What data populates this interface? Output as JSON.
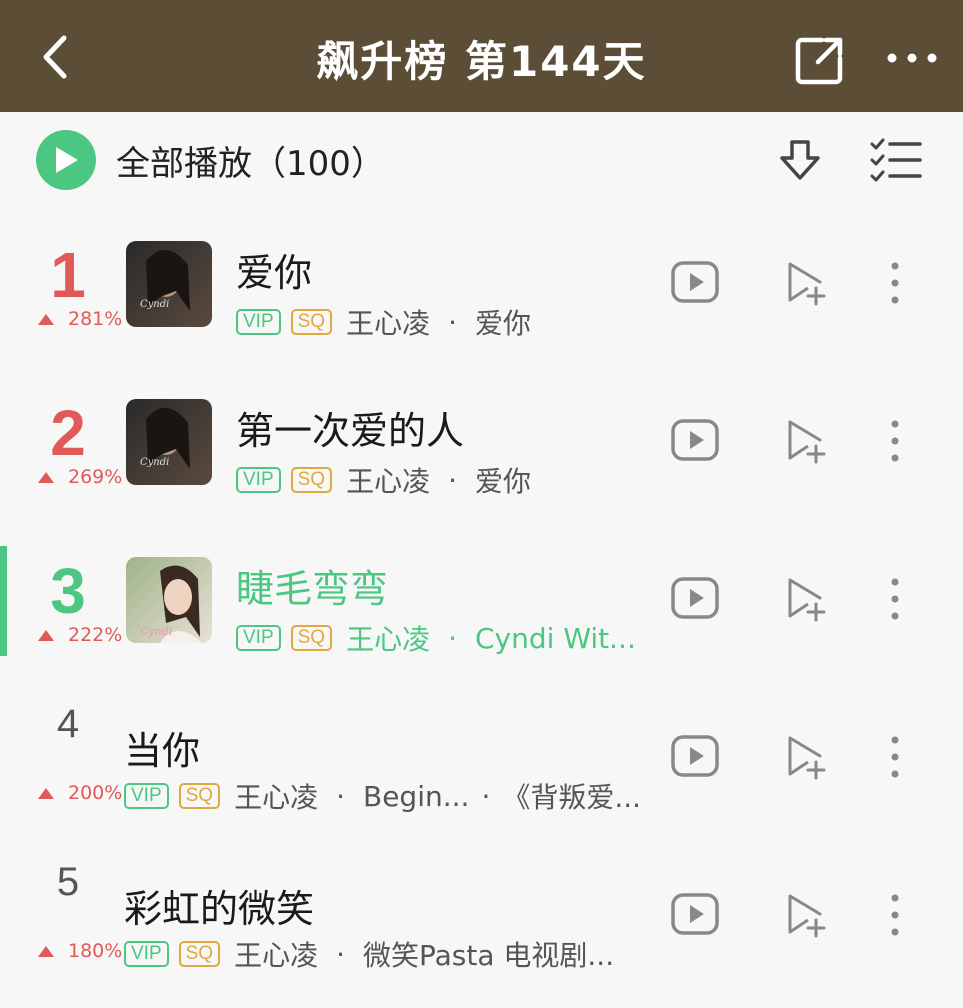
{
  "header": {
    "title": "飙升榜 第144天",
    "back_icon": "chevron-left-icon",
    "share_icon": "share-external-icon",
    "more_icon": "more-horizontal-icon"
  },
  "toolbar": {
    "play_all_label": "全部播放（100）",
    "play_icon": "play-circle-icon",
    "download_icon": "download-icon",
    "multiselect_icon": "checklist-icon"
  },
  "colors": {
    "header_bg": "#5b4d36",
    "accent_green": "#4cc781",
    "rank_red": "#e05a57",
    "sq_gold": "#e0a940"
  },
  "songs": [
    {
      "rank": "1",
      "trend": "281%",
      "title": "爱你",
      "vip": "VIP",
      "sq": "SQ",
      "artist": "王心凌",
      "sep": "·",
      "album": "爱你",
      "active": false
    },
    {
      "rank": "2",
      "trend": "269%",
      "title": "第一次爱的人",
      "vip": "VIP",
      "sq": "SQ",
      "artist": "王心凌",
      "sep": "·",
      "album": "爱你",
      "active": false
    },
    {
      "rank": "3",
      "trend": "222%",
      "title": "睫毛弯弯",
      "vip": "VIP",
      "sq": "SQ",
      "artist": "王心凌",
      "sep": "·",
      "album": "Cyndi Wit...",
      "active": true
    },
    {
      "rank": "4",
      "trend": "200%",
      "title": "当你",
      "vip": "VIP",
      "sq": "SQ",
      "artist": "王心凌",
      "sep": "·",
      "album": "Begin...",
      "sep2": "·",
      "album2": "《背叛爱...",
      "active": false
    },
    {
      "rank": "5",
      "trend": "180%",
      "title": "彩虹的微笑",
      "vip": "VIP",
      "sq": "SQ",
      "artist": "王心凌",
      "sep": "·",
      "album": "微笑Pasta 电视剧...",
      "active": false
    }
  ]
}
